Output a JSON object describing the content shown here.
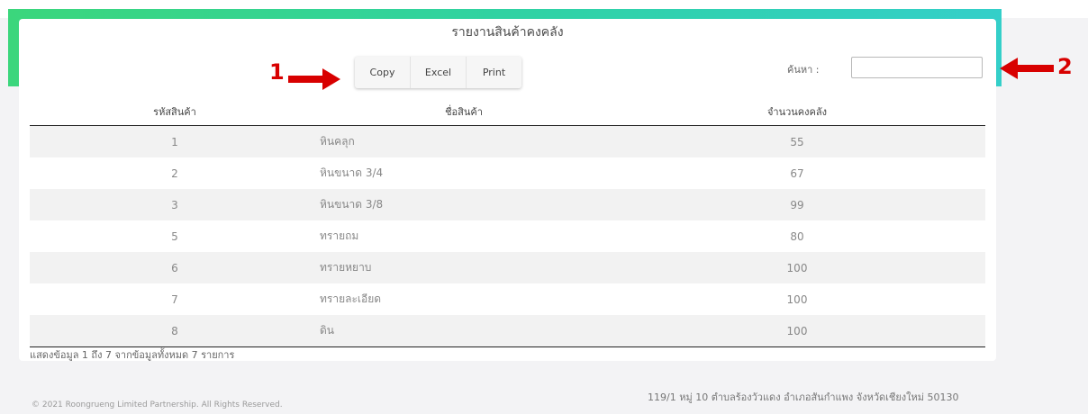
{
  "report": {
    "title": "รายงานสินค้าคงคลัง",
    "buttons": {
      "copy": "Copy",
      "excel": "Excel",
      "print": "Print"
    },
    "search": {
      "label": "ค้นหา :",
      "value": ""
    },
    "columns": {
      "code": "รหัสสินค้า",
      "name": "ชื่อสินค้า",
      "qty": "จำนวนคงคลัง"
    },
    "rows": [
      {
        "code": "1",
        "name": "หินคลุก",
        "qty": "55"
      },
      {
        "code": "2",
        "name": "หินขนาด 3/4",
        "qty": "67"
      },
      {
        "code": "3",
        "name": "หินขนาด 3/8",
        "qty": "99"
      },
      {
        "code": "5",
        "name": "ทรายถม",
        "qty": "80"
      },
      {
        "code": "6",
        "name": "ทรายหยาบ",
        "qty": "100"
      },
      {
        "code": "7",
        "name": "ทรายละเอียด",
        "qty": "100"
      },
      {
        "code": "8",
        "name": "ดิน",
        "qty": "100"
      }
    ],
    "info": "แสดงข้อมูล 1 ถึง 7 จากข้อมูลทั้งหมด 7 รายการ"
  },
  "footer": {
    "copyright": "© 2021 Roongrueng Limited Partnership. All Rights Reserved.",
    "address": "119/1 หมู่ 10 ตำบลร้องวัวแดง อำเภอสันกำแพง จังหวัดเชียงใหม่ 50130"
  },
  "annotations": {
    "one": "1",
    "two": "2"
  },
  "colors": {
    "band_start": "#3bd67c",
    "band_end": "#34cfc9",
    "annotation": "#d80000"
  }
}
